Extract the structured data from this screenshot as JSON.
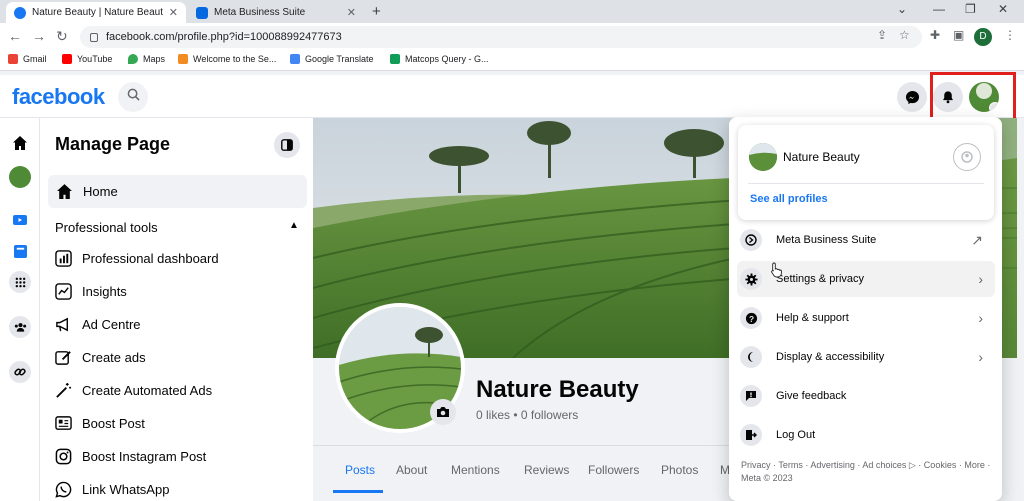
{
  "browser": {
    "tabs": [
      {
        "title": "Nature Beauty | Nature Beauty. Ir",
        "active": true
      },
      {
        "title": "Meta Business Suite",
        "active": false
      }
    ],
    "url": "facebook.com/profile.php?id=100088992477673",
    "profile_initial": "D",
    "bookmarks": [
      {
        "label": "Gmail",
        "color": "#ea4335"
      },
      {
        "label": "YouTube",
        "color": "#ff0000"
      },
      {
        "label": "Maps",
        "color": "#34a853"
      },
      {
        "label": "Welcome to the Se...",
        "color": "#f28b22"
      },
      {
        "label": "Google Translate",
        "color": "#4285f4"
      },
      {
        "label": "Matcops Query - G...",
        "color": "#0f9d58"
      }
    ]
  },
  "facebook": {
    "logo": "facebook",
    "accent": "#1877f2"
  },
  "sidebar": {
    "title": "Manage Page",
    "home_label": "Home",
    "section_label": "Professional tools",
    "items": [
      {
        "label": "Professional dashboard",
        "icon": "dashboard-icon"
      },
      {
        "label": "Insights",
        "icon": "insights-icon"
      },
      {
        "label": "Ad Centre",
        "icon": "megaphone-icon"
      },
      {
        "label": "Create ads",
        "icon": "pencil-icon"
      },
      {
        "label": "Create Automated Ads",
        "icon": "magic-wand-icon"
      },
      {
        "label": "Boost Post",
        "icon": "boost-post-icon"
      },
      {
        "label": "Boost Instagram Post",
        "icon": "instagram-icon"
      },
      {
        "label": "Link WhatsApp",
        "icon": "whatsapp-icon"
      }
    ]
  },
  "page": {
    "name": "Nature Beauty",
    "stats": "0 likes • 0 followers",
    "tabs": [
      "Posts",
      "About",
      "Mentions",
      "Reviews",
      "Followers",
      "Photos",
      "M"
    ]
  },
  "dropdown": {
    "profile_name": "Nature Beauty",
    "see_all": "See all profiles",
    "items": [
      {
        "label": "Meta Business Suite",
        "icon": "meta-business-icon",
        "arrow": "↗"
      },
      {
        "label": "Settings & privacy",
        "icon": "gear-icon",
        "arrow": "›"
      },
      {
        "label": "Help & support",
        "icon": "help-icon",
        "arrow": "›"
      },
      {
        "label": "Display & accessibility",
        "icon": "moon-icon",
        "arrow": "›"
      },
      {
        "label": "Give feedback",
        "icon": "feedback-icon",
        "arrow": ""
      },
      {
        "label": "Log Out",
        "icon": "logout-icon",
        "arrow": ""
      }
    ],
    "footer": "Privacy · Terms · Advertising · Ad choices ▷ · Cookies · More · Meta © 2023"
  }
}
